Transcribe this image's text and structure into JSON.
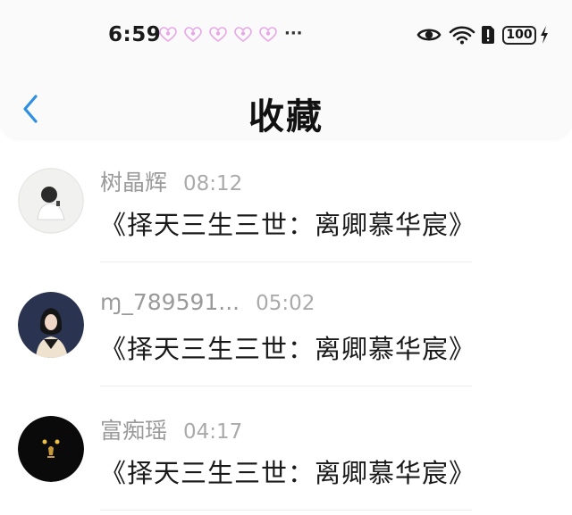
{
  "status_bar": {
    "time": "6:59",
    "more": "···",
    "battery": "100"
  },
  "header": {
    "title": "收藏",
    "back_icon": "chevron-left-icon"
  },
  "colors": {
    "accent": "#2f8fe0",
    "heart": "#e6a6e6"
  },
  "favorites": [
    {
      "user": "树晶辉",
      "time": "08:12",
      "title": "《择天三生三世：离卿慕华宸》"
    },
    {
      "user": "ɱ_789591...",
      "time": "05:02",
      "title": "《择天三生三世：离卿慕华宸》"
    },
    {
      "user": "富痴瑶",
      "time": "04:17",
      "title": "《择天三生三世：离卿慕华宸》"
    }
  ]
}
